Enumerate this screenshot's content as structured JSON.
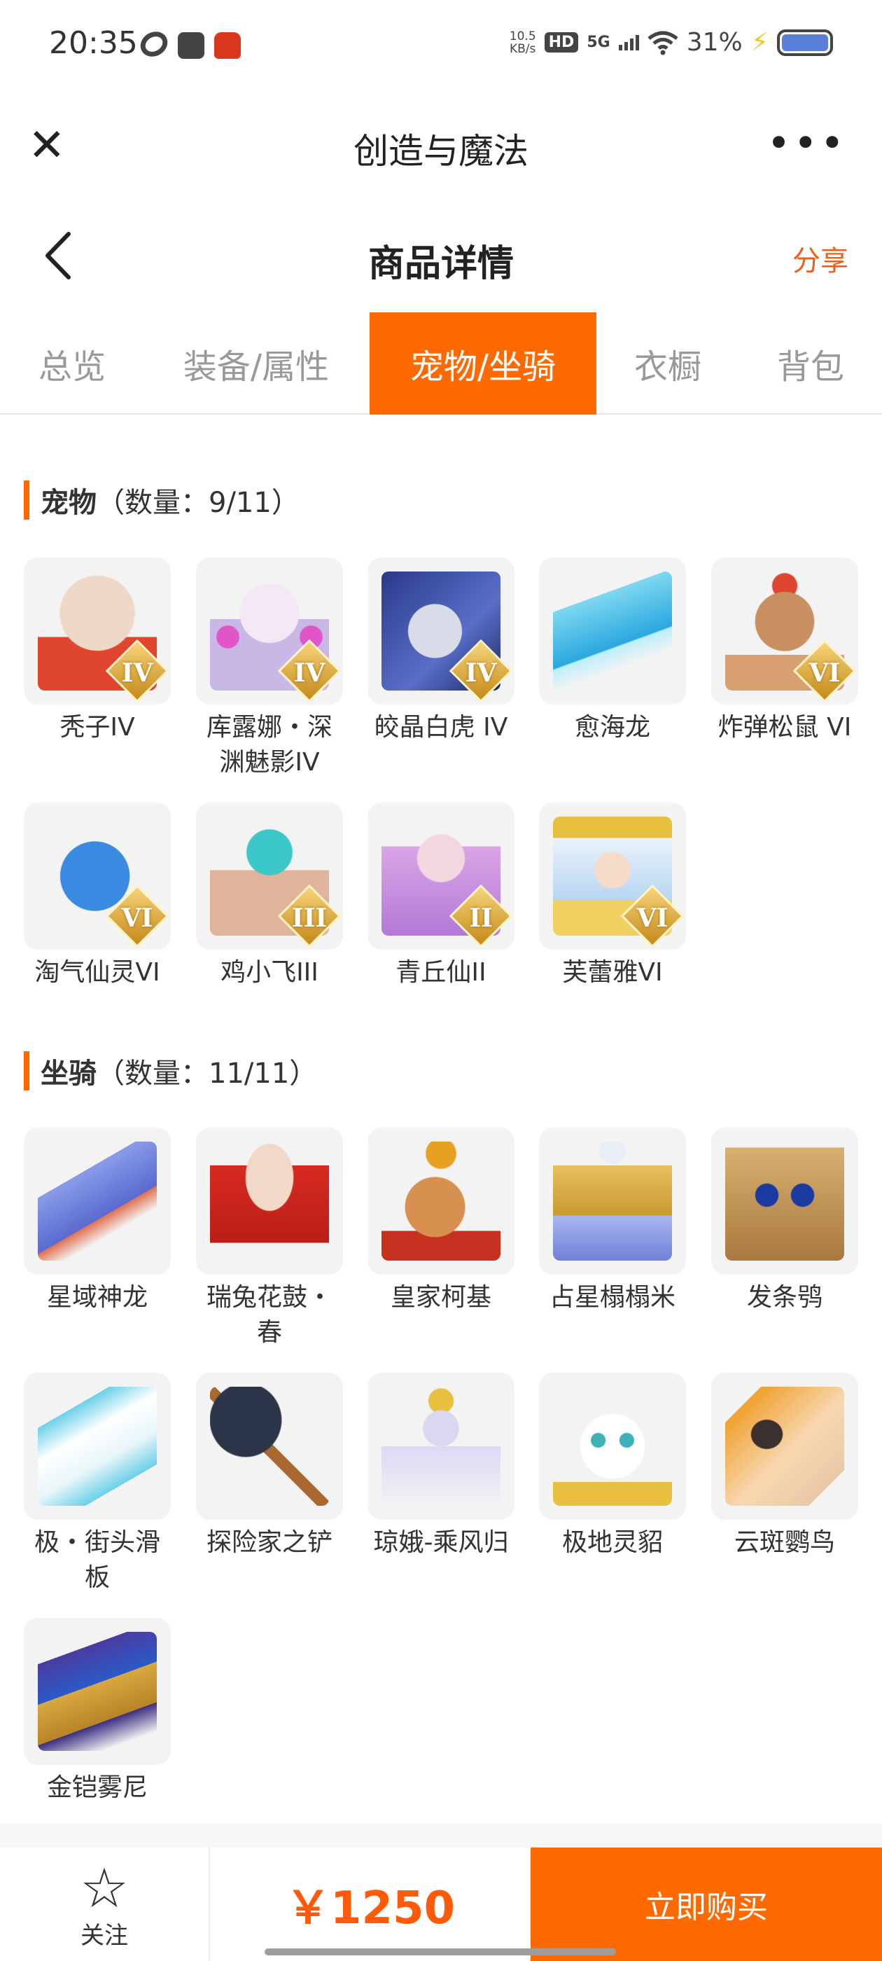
{
  "status_bar": {
    "time": "20:35",
    "net_speed_value": "10.5",
    "net_speed_unit": "KB/s",
    "hd": "HD",
    "network": "5G",
    "battery_pct": "31%"
  },
  "mini_program": {
    "title": "创造与魔法"
  },
  "nav": {
    "title": "商品详情",
    "share": "分享"
  },
  "tabs": [
    {
      "label": "总览",
      "active": false
    },
    {
      "label": "装备/属性",
      "active": false
    },
    {
      "label": "宠物/坐骑",
      "active": true
    },
    {
      "label": "衣橱",
      "active": false
    },
    {
      "label": "背包",
      "active": false
    }
  ],
  "pets": {
    "title": "宠物",
    "count": "（数量：9/11）",
    "items": [
      {
        "name": "秃子IV",
        "level": "IV"
      },
      {
        "name": "库露娜・深渊魅影IV",
        "level": "IV"
      },
      {
        "name": "皎晶白虎 IV",
        "level": "IV"
      },
      {
        "name": "愈海龙",
        "level": ""
      },
      {
        "name": "炸弹松鼠 VI",
        "level": "VI"
      },
      {
        "name": "淘气仙灵VI",
        "level": "VI"
      },
      {
        "name": "鸡小飞III",
        "level": "III"
      },
      {
        "name": "青丘仙II",
        "level": "II"
      },
      {
        "name": "芙蕾雅VI",
        "level": "VI"
      }
    ]
  },
  "mounts": {
    "title": "坐骑",
    "count": "（数量：11/11）",
    "items": [
      {
        "name": "星域神龙"
      },
      {
        "name": "瑞兔花鼓・春"
      },
      {
        "name": "皇家柯基"
      },
      {
        "name": "占星榻榻米"
      },
      {
        "name": "发条鸮"
      },
      {
        "name": "极・街头滑板"
      },
      {
        "name": "探险家之铲"
      },
      {
        "name": "琼娥-乘风归"
      },
      {
        "name": "极地灵貂"
      },
      {
        "name": "云斑鹦鸟"
      },
      {
        "name": "金铠雾尼"
      }
    ]
  },
  "bottom_bar": {
    "follow": "关注",
    "price": "￥1250",
    "buy": "立即购买"
  },
  "colors": {
    "accent": "#ff6a00",
    "price": "#ff5a0a",
    "share": "#e8621c"
  }
}
